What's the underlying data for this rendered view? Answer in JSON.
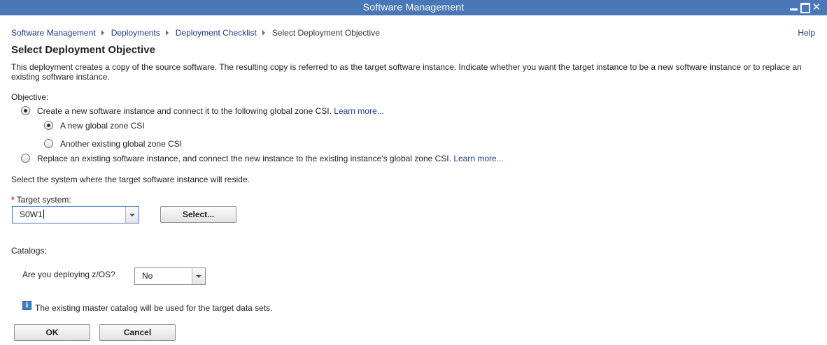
{
  "window": {
    "title": "Software Management"
  },
  "breadcrumb": {
    "items": [
      "Software Management",
      "Deployments",
      "Deployment Checklist"
    ],
    "current": "Select Deployment Objective"
  },
  "help_label": "Help",
  "page": {
    "title": "Select Deployment Objective",
    "description": "This deployment creates a copy of the source software. The resulting copy is referred to as the target software instance. Indicate whether you want the target instance to be a new software instance or to replace an existing software instance."
  },
  "objective": {
    "label": "Objective:",
    "option_new": "Create a new software instance and connect it to the following global zone CSI.",
    "option_new_link": "Learn more...",
    "sub_new_csi": "A new global zone CSI",
    "sub_existing_csi": "Another existing global zone CSI",
    "option_replace": "Replace an existing software instance, and connect the new instance to the existing instance's global zone CSI.",
    "option_replace_link": "Learn more..."
  },
  "system": {
    "prompt": "Select the system where the target software instance will reside.",
    "required_marker": "*",
    "target_label": "Target system:",
    "target_value": "S0W1",
    "select_button": "Select..."
  },
  "catalogs": {
    "label": "Catalogs:",
    "zos_question": "Are you deploying z/OS?",
    "zos_value": "No",
    "info_icon_glyph": "i",
    "info_text": "The existing master catalog will be used for the target data sets."
  },
  "buttons": {
    "ok": "OK",
    "cancel": "Cancel"
  }
}
